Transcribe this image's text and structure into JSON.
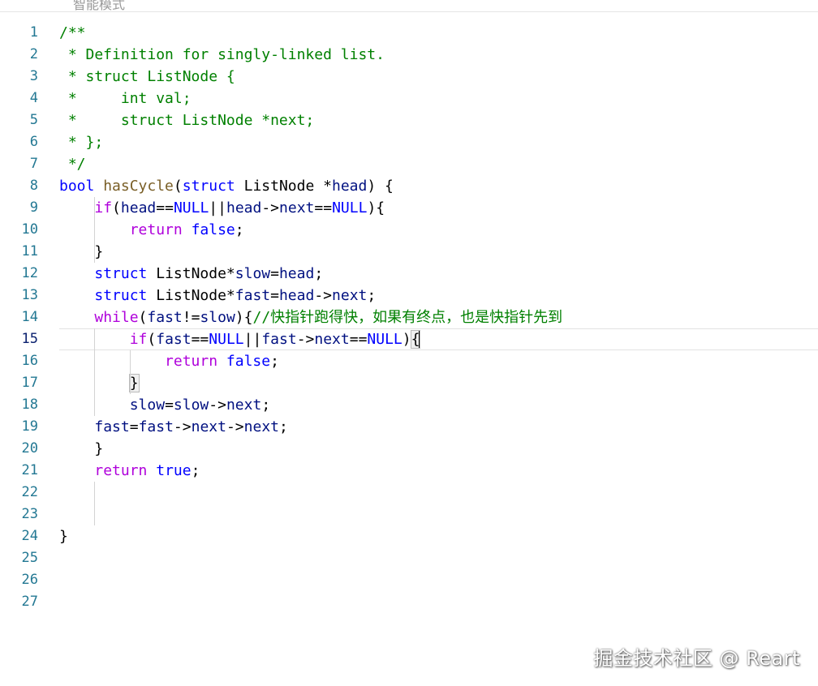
{
  "header": {
    "partial_text": "智能模式"
  },
  "editor": {
    "current_line": 15,
    "lines": [
      {
        "n": "1"
      },
      {
        "n": "2"
      },
      {
        "n": "3"
      },
      {
        "n": "4"
      },
      {
        "n": "5"
      },
      {
        "n": "6"
      },
      {
        "n": "7"
      },
      {
        "n": "8"
      },
      {
        "n": "9"
      },
      {
        "n": "10"
      },
      {
        "n": "11"
      },
      {
        "n": "12"
      },
      {
        "n": "13"
      },
      {
        "n": "14"
      },
      {
        "n": "15"
      },
      {
        "n": "16"
      },
      {
        "n": "17"
      },
      {
        "n": "18"
      },
      {
        "n": "19"
      },
      {
        "n": "20"
      },
      {
        "n": "21"
      },
      {
        "n": "22"
      },
      {
        "n": "23"
      },
      {
        "n": "24"
      },
      {
        "n": "25"
      },
      {
        "n": "26"
      },
      {
        "n": "27"
      }
    ],
    "code": [
      [
        [
          "cm",
          "/**"
        ]
      ],
      [
        [
          "cm",
          " * Definition for singly-linked list."
        ]
      ],
      [
        [
          "cm",
          " * struct ListNode {"
        ]
      ],
      [
        [
          "cm",
          " *     int val;"
        ]
      ],
      [
        [
          "cm",
          " *     struct ListNode *next;"
        ]
      ],
      [
        [
          "cm",
          " * };"
        ]
      ],
      [
        [
          "cm",
          " */"
        ]
      ],
      [
        [
          "kw",
          "bool"
        ],
        [
          "op",
          " "
        ],
        [
          "fn",
          "hasCycle"
        ],
        [
          "op",
          "("
        ],
        [
          "kw",
          "struct"
        ],
        [
          "op",
          " ListNode *"
        ],
        [
          "var",
          "head"
        ],
        [
          "op",
          ") {"
        ]
      ],
      [
        [
          "op",
          "    "
        ],
        [
          "ctl",
          "if"
        ],
        [
          "op",
          "("
        ],
        [
          "var",
          "head"
        ],
        [
          "op",
          "=="
        ],
        [
          "const",
          "NULL"
        ],
        [
          "op",
          "||"
        ],
        [
          "var",
          "head"
        ],
        [
          "op",
          "->"
        ],
        [
          "var",
          "next"
        ],
        [
          "op",
          "=="
        ],
        [
          "const",
          "NULL"
        ],
        [
          "op",
          "){"
        ]
      ],
      [
        [
          "op",
          "        "
        ],
        [
          "ctl",
          "return"
        ],
        [
          "op",
          " "
        ],
        [
          "const",
          "false"
        ],
        [
          "op",
          ";"
        ]
      ],
      [
        [
          "op",
          "    }"
        ]
      ],
      [
        [
          "op",
          "    "
        ],
        [
          "kw",
          "struct"
        ],
        [
          "op",
          " ListNode*"
        ],
        [
          "var",
          "slow"
        ],
        [
          "op",
          "="
        ],
        [
          "var",
          "head"
        ],
        [
          "op",
          ";"
        ]
      ],
      [
        [
          "op",
          "    "
        ],
        [
          "kw",
          "struct"
        ],
        [
          "op",
          " ListNode*"
        ],
        [
          "var",
          "fast"
        ],
        [
          "op",
          "="
        ],
        [
          "var",
          "head"
        ],
        [
          "op",
          "->"
        ],
        [
          "var",
          "next"
        ],
        [
          "op",
          ";"
        ]
      ],
      [
        [
          "op",
          "    "
        ],
        [
          "ctl",
          "while"
        ],
        [
          "op",
          "("
        ],
        [
          "var",
          "fast"
        ],
        [
          "op",
          "!="
        ],
        [
          "var",
          "slow"
        ],
        [
          "op",
          "){"
        ],
        [
          "cm",
          "//快指针跑得快，如果有终点，也是快指针先到"
        ]
      ],
      [
        [
          "op",
          "        "
        ],
        [
          "ctl",
          "if"
        ],
        [
          "op",
          "("
        ],
        [
          "var",
          "fast"
        ],
        [
          "op",
          "=="
        ],
        [
          "const",
          "NULL"
        ],
        [
          "op",
          "||"
        ],
        [
          "var",
          "fast"
        ],
        [
          "op",
          "->"
        ],
        [
          "var",
          "next"
        ],
        [
          "op",
          "=="
        ],
        [
          "const",
          "NULL"
        ],
        [
          "op",
          ")"
        ],
        [
          "match",
          "{"
        ]
      ],
      [
        [
          "op",
          "            "
        ],
        [
          "ctl",
          "return"
        ],
        [
          "op",
          " "
        ],
        [
          "const",
          "false"
        ],
        [
          "op",
          ";"
        ]
      ],
      [
        [
          "op",
          "        "
        ],
        [
          "match",
          "}"
        ]
      ],
      [
        [
          "op",
          "        "
        ],
        [
          "var",
          "slow"
        ],
        [
          "op",
          "="
        ],
        [
          "var",
          "slow"
        ],
        [
          "op",
          "->"
        ],
        [
          "var",
          "next"
        ],
        [
          "op",
          ";"
        ]
      ],
      [
        [
          "op",
          "    "
        ],
        [
          "var",
          "fast"
        ],
        [
          "op",
          "="
        ],
        [
          "var",
          "fast"
        ],
        [
          "op",
          "->"
        ],
        [
          "var",
          "next"
        ],
        [
          "op",
          "->"
        ],
        [
          "var",
          "next"
        ],
        [
          "op",
          ";"
        ]
      ],
      [
        [
          "op",
          "    }"
        ]
      ],
      [
        [
          "op",
          "    "
        ],
        [
          "ctl",
          "return"
        ],
        [
          "op",
          " "
        ],
        [
          "const",
          "true"
        ],
        [
          "op",
          ";"
        ]
      ],
      [],
      [],
      [
        [
          "op",
          "}"
        ]
      ],
      [],
      [],
      []
    ]
  },
  "watermark": {
    "text": "掘金技术社区 @ Reart"
  }
}
